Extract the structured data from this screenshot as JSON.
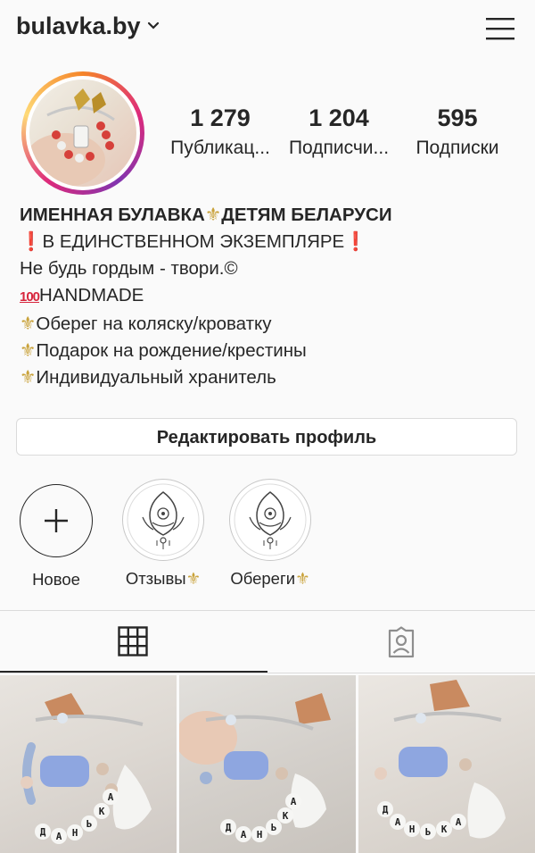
{
  "header": {
    "username": "bulavka.by"
  },
  "stats": [
    {
      "number": "1 279",
      "label": "Публикац..."
    },
    {
      "number": "1 204",
      "label": "Подписчи..."
    },
    {
      "number": "595",
      "label": "Подписки"
    }
  ],
  "bio": {
    "name": "ИМЕННАЯ БУЛАВКА",
    "name_tail": "ДЕТЯМ БЕЛАРУСИ",
    "line1": "В ЕДИНСТВЕННОМ ЭКЗЕМПЛЯРЕ",
    "line2": "Не будь гордым - твори.©",
    "line3_badge": "100",
    "line3": "HANDMADE",
    "line4": "Оберег на коляску/кроватку",
    "line5": "Подарок на рождение/крестины",
    "line6": "Индивидуальный хранитель"
  },
  "edit_profile_label": "Редактировать профиль",
  "highlights": [
    {
      "label": "Новое"
    },
    {
      "label": "Отзывы"
    },
    {
      "label": "Обереги"
    }
  ],
  "photo_letters": "ДАНЬКА",
  "colors": {
    "accent_gold": "#c9a23a",
    "divider": "#dbdbdb",
    "text": "#262626"
  }
}
